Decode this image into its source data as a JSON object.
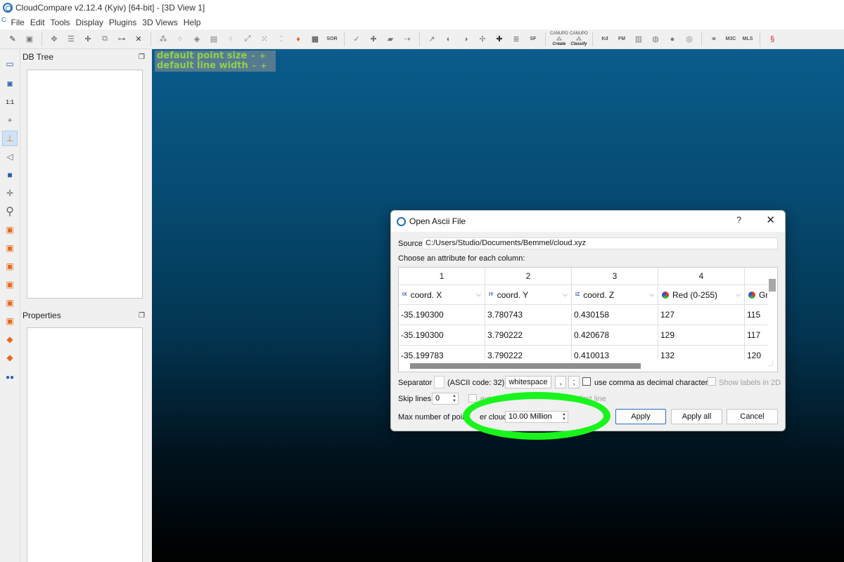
{
  "window": {
    "title": "CloudCompare v2.12.4 (Kyiv) [64-bit] - [3D View 1]"
  },
  "menubar": {
    "items": [
      "File",
      "Edit",
      "Tools",
      "Display",
      "Plugins",
      "3D Views",
      "Help"
    ]
  },
  "toolbar": {
    "sor_label": "SOR",
    "sf_label": "SF",
    "canupo_create": {
      "top": "CANUPO",
      "bottom": "Create"
    },
    "canupo_classify": {
      "top": "CANUPO",
      "bottom": "Classify"
    },
    "kd_label": "Kd",
    "fm_label": "FM",
    "mc_label": "M3C",
    "mls_label": "MLS"
  },
  "left_toolbar": {
    "scale_label": "1:1"
  },
  "db_tree": {
    "title": "DB Tree"
  },
  "properties": {
    "title": "Properties"
  },
  "view_overlay": {
    "point_size_label": "default point size",
    "line_width_label": "default line width",
    "minus": "–",
    "plus": "+"
  },
  "dialog": {
    "title": "Open Ascii File",
    "help": "?",
    "close": "✕",
    "source_label": "Source",
    "source_value": "C:/Users/Studio/Documents/Bemmel/cloud.xyz",
    "choose_label": "Choose an attribute for each column:",
    "columns": [
      {
        "number": "1",
        "attribute": "coord. X",
        "icon": "IX"
      },
      {
        "number": "2",
        "attribute": "coord. Y",
        "icon": "IY"
      },
      {
        "number": "3",
        "attribute": "coord. Z",
        "icon": "IZ"
      },
      {
        "number": "4",
        "attribute": "Red (0-255)",
        "icon": "rgb"
      },
      {
        "number": "",
        "attribute": "Gr",
        "icon": "rgb"
      }
    ],
    "rows": [
      [
        "-35.190300",
        "3.780743",
        "0.430158",
        "127",
        "115"
      ],
      [
        "-35.190300",
        "3.790222",
        "0.420678",
        "129",
        "117"
      ],
      [
        "-35.199783",
        "3.790222",
        "0.410013",
        "132",
        "120"
      ]
    ],
    "separator_label": "Separator",
    "ascii_code_label": "(ASCII code: 32)",
    "whitespace_btn": "whitespace",
    "comma_btn": ",",
    "semicolon_btn": ";",
    "decimal_comma_label": "use comma as decimal character",
    "show_labels_label": "Show labels in 2D",
    "skip_lines_label": "Skip lines",
    "skip_lines_value": "0",
    "extract_label_start": "extr",
    "extract_label_end": "first line",
    "max_points_label_a": "Max number of poin",
    "max_points_label_b": "er cloud",
    "max_points_value": "10.00 Million",
    "apply_btn": "Apply",
    "apply_all_btn": "Apply all",
    "cancel_btn": "Cancel"
  }
}
